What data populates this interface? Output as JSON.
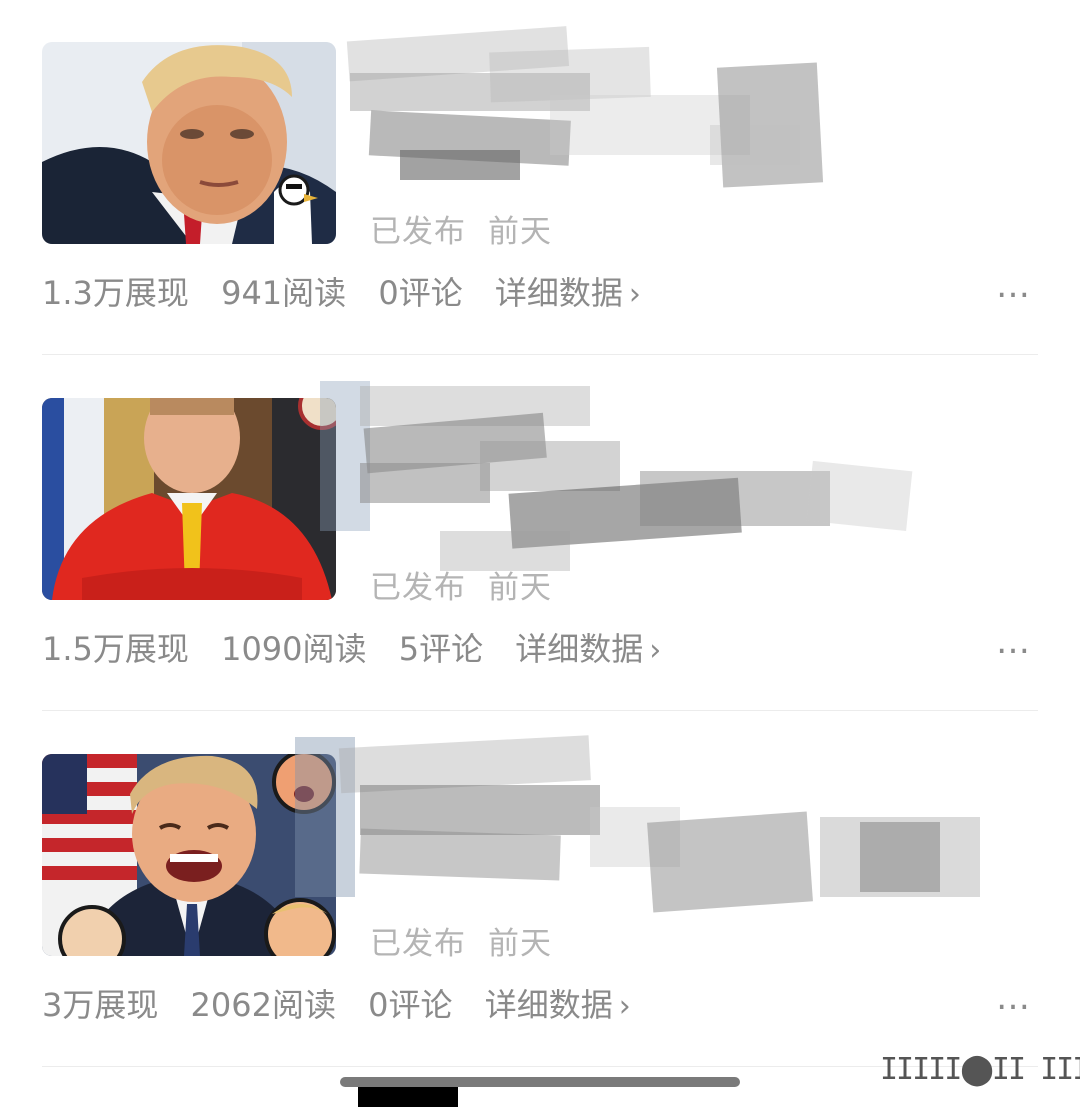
{
  "articles": [
    {
      "status": "已发布",
      "date": "前天",
      "impressions": "1.3万展现",
      "reads": "941阅读",
      "comments": "0评论",
      "detail_label": "详细数据",
      "more_label": "…",
      "thumbnail": "portrait-man-suit-red-tie"
    },
    {
      "status": "已发布",
      "date": "前天",
      "impressions": "1.5万展现",
      "reads": "1090阅读",
      "comments": "5评论",
      "detail_label": "详细数据",
      "more_label": "…",
      "thumbnail": "portrait-man-red-suit-yellow-tie"
    },
    {
      "status": "已发布",
      "date": "前天",
      "impressions": "3万展现",
      "reads": "2062阅读",
      "comments": "0评论",
      "detail_label": "详细数据",
      "more_label": "…",
      "thumbnail": "portrait-laughing-man-with-stickers"
    }
  ],
  "chevron_icon": "chevron-right-icon",
  "colors": {
    "meta_text": "#8a8a8a",
    "status_text": "#b4b4b4",
    "divider": "#ececec",
    "background": "#ffffff"
  },
  "corner_glyphs": "IIIII⬤II III"
}
